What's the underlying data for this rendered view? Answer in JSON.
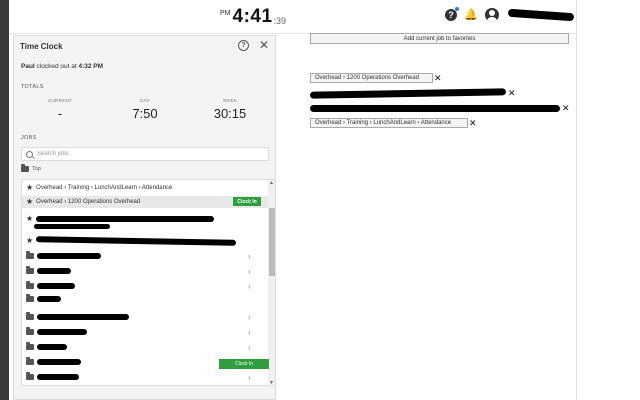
{
  "header": {
    "clock": {
      "ampm": "PM",
      "time": "4:41",
      "seconds": ":39"
    },
    "help_icon": "?"
  },
  "panel": {
    "title": "Time Clock",
    "help_icon": "?",
    "close_icon": "✕",
    "status": {
      "name": "Paul",
      "text": " clocked out at ",
      "time": "4:32 PM"
    },
    "totals_label": "TOTALS",
    "totals": [
      {
        "label": "CURRENT",
        "value": "-"
      },
      {
        "label": "DAY",
        "value": "7:50"
      },
      {
        "label": "WEEK",
        "value": "30:15"
      }
    ],
    "jobs_label": "JOBS",
    "search_placeholder": "Search jobs",
    "top_label": "Top",
    "list": {
      "favorites": [
        {
          "label": "Overhead › Training › LunchAndLearn › Attendance"
        },
        {
          "label": "Overhead › 1200 Operations Overhead",
          "button": "Clock In"
        }
      ]
    },
    "bottom_button": "Clock In"
  },
  "favorites_panel": {
    "add_button": "Add current job to favorites",
    "chips": [
      {
        "label": "Overhead › 1200 Operations Overhead"
      },
      {
        "label": "Overhead › Training › LunchAndLearn › Attendance"
      }
    ],
    "chip_remove": "✕"
  }
}
